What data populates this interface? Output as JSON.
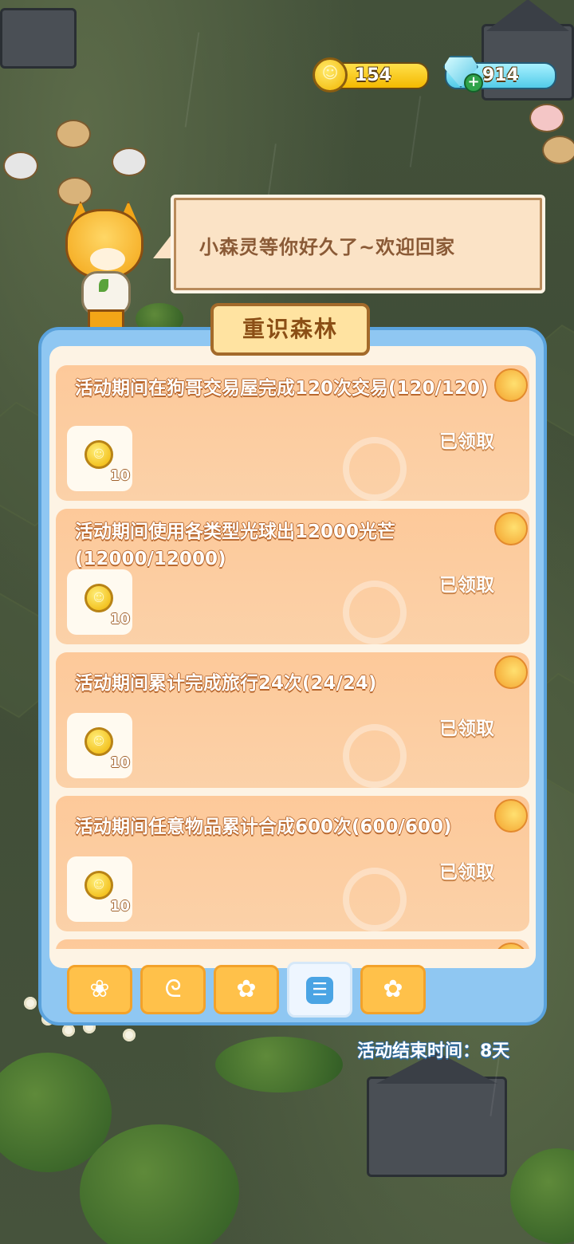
{
  "currency": {
    "coins": "154",
    "gems": "914",
    "coin_icon": "gold-coin-icon",
    "gem_icon": "diamond-gem-icon",
    "add_icon": "plus-icon"
  },
  "dialog": {
    "message": "小森灵等你好久了~欢迎回家"
  },
  "panel": {
    "title": "重识森林",
    "tasks": [
      {
        "title": "活动期间在狗哥交易屋完成120次交易(120/120)",
        "reward_qty": "10",
        "status": "已领取"
      },
      {
        "title": "活动期间使用各类型光球出12000光芒(12000/12000)",
        "reward_qty": "10",
        "status": "已领取"
      },
      {
        "title": "活动期间累计完成旅行24次(24/24)",
        "reward_qty": "10",
        "status": "已领取"
      },
      {
        "title": "活动期间任意物品累计合成600次(600/600)",
        "reward_qty": "10",
        "status": "已领取"
      }
    ],
    "tabs": [
      {
        "icon": "cats-icon"
      },
      {
        "icon": "swirl-bag-icon"
      },
      {
        "icon": "cat-coins-icon"
      },
      {
        "icon": "list-icon"
      },
      {
        "icon": "cat-coins-icon"
      }
    ],
    "active_tab": 3,
    "end_time": "活动结束时间：8天"
  },
  "colors": {
    "panel_border": "#5aa2dc",
    "task_bg": "#fdc99a",
    "tab_bg": "#ffc14a",
    "title_text": "#8b4f16"
  }
}
